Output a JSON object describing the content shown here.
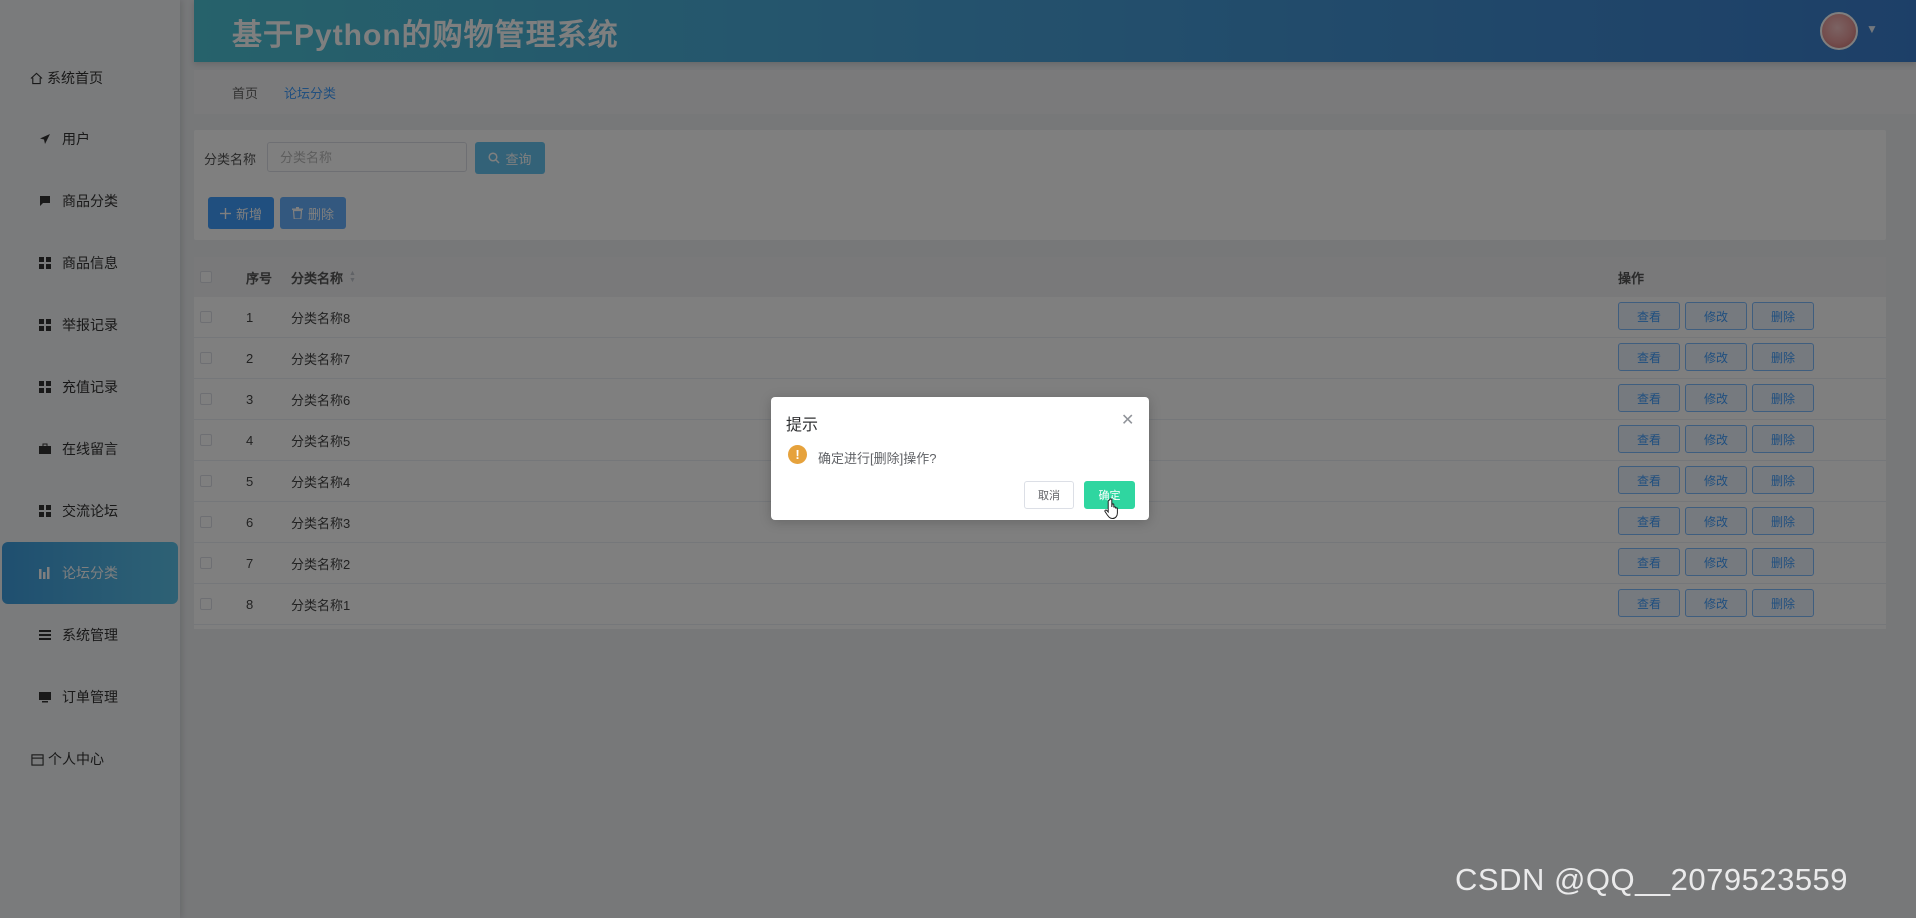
{
  "header": {
    "title": "基于Python的购物管理系统"
  },
  "sidebar": {
    "items": [
      {
        "label": "系统首页",
        "icon": "home-icon"
      },
      {
        "label": "用户",
        "icon": "send-icon"
      },
      {
        "label": "商品分类",
        "icon": "chat-icon"
      },
      {
        "label": "商品信息",
        "icon": "grid-icon"
      },
      {
        "label": "举报记录",
        "icon": "grid-icon"
      },
      {
        "label": "充值记录",
        "icon": "grid-icon"
      },
      {
        "label": "在线留言",
        "icon": "briefcase-icon"
      },
      {
        "label": "交流论坛",
        "icon": "grid-icon"
      },
      {
        "label": "论坛分类",
        "icon": "chart-icon",
        "active": true
      },
      {
        "label": "系统管理",
        "icon": "list-icon"
      },
      {
        "label": "订单管理",
        "icon": "monitor-icon"
      },
      {
        "label": "个人中心",
        "icon": "calendar-icon"
      }
    ]
  },
  "breadcrumb": {
    "home": "首页",
    "current": "论坛分类"
  },
  "search": {
    "label": "分类名称",
    "placeholder": "分类名称",
    "value": "",
    "query_label": "查询",
    "add_label": "新增",
    "delete_label": "删除"
  },
  "table": {
    "headers": {
      "index": "序号",
      "name": "分类名称",
      "ops": "操作"
    },
    "op_labels": {
      "view": "查看",
      "edit": "修改",
      "delete": "删除"
    },
    "rows": [
      {
        "index": "1",
        "name": "分类名称8"
      },
      {
        "index": "2",
        "name": "分类名称7"
      },
      {
        "index": "3",
        "name": "分类名称6"
      },
      {
        "index": "4",
        "name": "分类名称5"
      },
      {
        "index": "5",
        "name": "分类名称4"
      },
      {
        "index": "6",
        "name": "分类名称3"
      },
      {
        "index": "7",
        "name": "分类名称2"
      },
      {
        "index": "8",
        "name": "分类名称1"
      }
    ]
  },
  "dialog": {
    "title": "提示",
    "message": "确定进行[删除]操作?",
    "cancel_label": "取消",
    "confirm_label": "确定"
  },
  "watermark": "CSDN @QQ__2079523559",
  "colors": {
    "primary": "#409eff",
    "confirm": "#2fd6a0",
    "warning": "#e6a23c"
  }
}
